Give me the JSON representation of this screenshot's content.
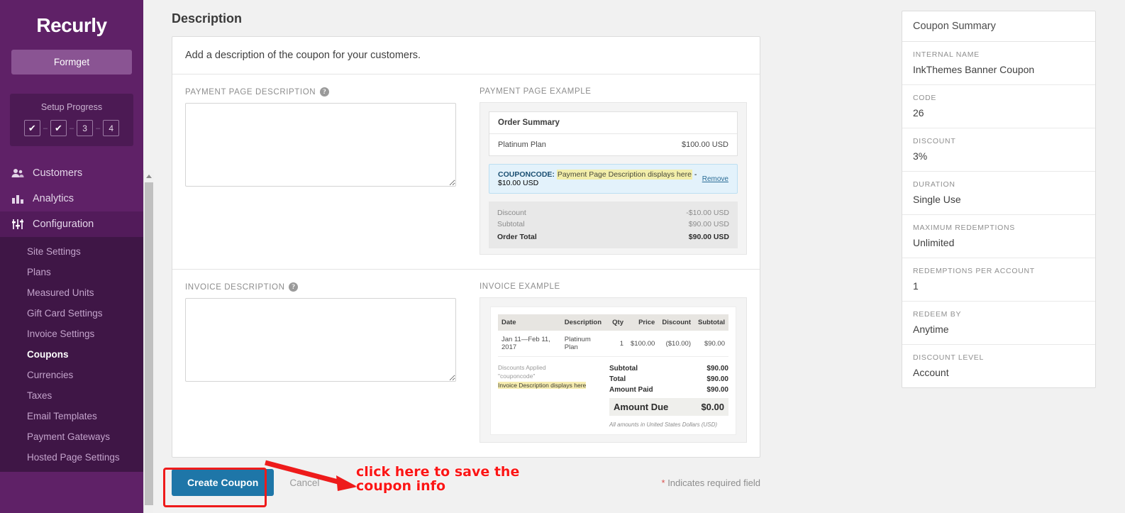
{
  "sidebar": {
    "brand": "Recurly",
    "org_button": "Formget",
    "setup": {
      "title": "Setup Progress",
      "steps": [
        {
          "label": "✔",
          "state": "done"
        },
        {
          "label": "✔",
          "state": "done"
        },
        {
          "label": "3",
          "state": "current"
        },
        {
          "label": "4",
          "state": "todo"
        }
      ]
    },
    "nav": [
      {
        "label": "Customers",
        "icon": "people-icon"
      },
      {
        "label": "Analytics",
        "icon": "bar-chart-icon"
      },
      {
        "label": "Configuration",
        "icon": "sliders-icon"
      }
    ],
    "subnav": [
      {
        "label": "Site Settings",
        "active": false
      },
      {
        "label": "Plans",
        "active": false
      },
      {
        "label": "Measured Units",
        "active": false
      },
      {
        "label": "Gift Card Settings",
        "active": false
      },
      {
        "label": "Invoice Settings",
        "active": false
      },
      {
        "label": "Coupons",
        "active": true
      },
      {
        "label": "Currencies",
        "active": false
      },
      {
        "label": "Taxes",
        "active": false
      },
      {
        "label": "Email Templates",
        "active": false
      },
      {
        "label": "Payment Gateways",
        "active": false
      },
      {
        "label": "Hosted Page Settings",
        "active": false
      }
    ]
  },
  "main": {
    "page_title": "Description",
    "intro": "Add a description of the coupon for your customers.",
    "payment_field": {
      "label": "PAYMENT PAGE DESCRIPTION",
      "help": "?",
      "value": "",
      "placeholder": ""
    },
    "invoice_field": {
      "label": "INVOICE DESCRIPTION",
      "help": "?",
      "value": "",
      "placeholder": ""
    },
    "payment_example": {
      "label": "PAYMENT PAGE EXAMPLE",
      "order_summary_title": "Order Summary",
      "plan_name": "Platinum Plan",
      "plan_price": "$100.00 USD",
      "coupon_code": "COUPONCODE:",
      "coupon_highlight": "Payment Page Description displays here",
      "coupon_amount": "- $10.00 USD",
      "remove_label": "Remove",
      "totals": [
        {
          "label": "Discount",
          "value": "-$10.00 USD"
        },
        {
          "label": "Subtotal",
          "value": "$90.00 USD"
        },
        {
          "label": "Order Total",
          "value": "$90.00 USD"
        }
      ]
    },
    "invoice_example": {
      "label": "INVOICE EXAMPLE",
      "columns": [
        "Date",
        "Description",
        "Qty",
        "Price",
        "Discount",
        "Subtotal"
      ],
      "rows": [
        [
          "Jan 11—Feb 11, 2017",
          "Platinum Plan",
          "1",
          "$100.00",
          "($10.00)",
          "$90.00"
        ]
      ],
      "discounts_applied_label": "Discounts Applied",
      "discounts_code": "\"couponcode\"",
      "discounts_highlight": "Invoice Description displays here",
      "totals": [
        {
          "label": "Subtotal",
          "value": "$90.00"
        },
        {
          "label": "Total",
          "value": "$90.00"
        },
        {
          "label": "Amount Paid",
          "value": "$90.00"
        }
      ],
      "amount_due_label": "Amount Due",
      "amount_due_value": "$0.00",
      "currency_note": "All amounts in United States Dollars (USD)"
    },
    "actions": {
      "create_label": "Create Coupon",
      "cancel_label": "Cancel",
      "required_star": "*",
      "required_note": " Indicates required field"
    },
    "annotation": {
      "text_line1": "click here to save the",
      "text_line2": "coupon info",
      "color": "#fb1616"
    }
  },
  "summary": {
    "title": "Coupon Summary",
    "rows": [
      {
        "label": "INTERNAL NAME",
        "value": "InkThemes Banner Coupon"
      },
      {
        "label": "CODE",
        "value": "26"
      },
      {
        "label": "DISCOUNT",
        "value": "3%"
      },
      {
        "label": "DURATION",
        "value": "Single Use"
      },
      {
        "label": "MAXIMUM REDEMPTIONS",
        "value": "Unlimited"
      },
      {
        "label": "REDEMPTIONS PER ACCOUNT",
        "value": "1"
      },
      {
        "label": "REDEEM BY",
        "value": "Anytime"
      },
      {
        "label": "DISCOUNT LEVEL",
        "value": "Account"
      }
    ]
  },
  "colors": {
    "sidebar": "#5f2167",
    "sidebar_sub": "#3f1646",
    "primary_button": "#1e76a8",
    "annotation": "#ee1b1b",
    "highlight": "#f2eeaa"
  }
}
